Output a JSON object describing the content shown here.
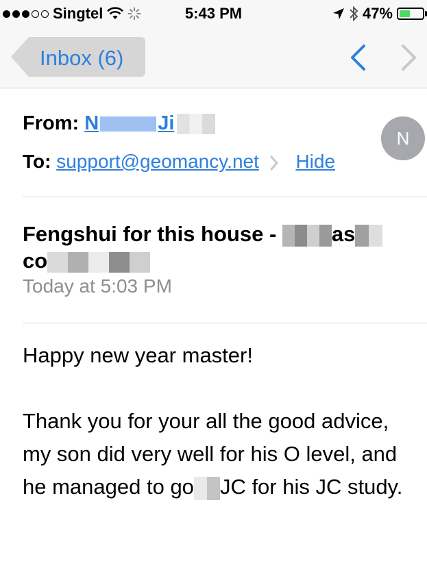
{
  "status": {
    "carrier": "Singtel",
    "time": "5:43 PM",
    "battery": "47%",
    "battery_level": 0.47,
    "signal_bars": 3
  },
  "nav": {
    "back_label": "Inbox (6)"
  },
  "email": {
    "from_label": "From:",
    "from_name_visible": "N",
    "from_name_visible2": "Ji",
    "to_label": "To:",
    "to_address": "support@geomancy.net",
    "hide_label": "Hide",
    "avatar_initial": "N",
    "subject_part1": "Fengshui for this house -",
    "subject_part2": "as",
    "subject_part3": "co",
    "date": "Today at 5:03 PM",
    "greeting": "Happy new year master!",
    "para1_before": "Thank you for your all the good advice, my son did very well for his O level, and he managed to go",
    "para1_after": "JC for his JC study."
  },
  "colors": {
    "link": "#2f7fdc",
    "gray_text": "#8e8e93",
    "avatar_bg": "#a6a8ae",
    "bar_bg": "#f7f7f7"
  }
}
